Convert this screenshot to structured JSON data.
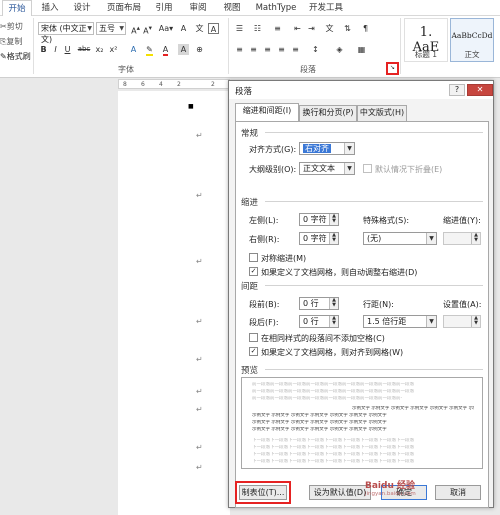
{
  "ribbon_tabs": [
    "开始",
    "插入",
    "设计",
    "页面布局",
    "引用",
    "审阅",
    "视图",
    "MathType",
    "开发工具"
  ],
  "clipboard": {
    "cut": "剪切",
    "copy": "复制",
    "painter": "格式刷"
  },
  "font": {
    "name": "宋体 (中文正文)",
    "size": "五号",
    "group_label": "字体"
  },
  "paragraph_group_label": "段落",
  "styles": [
    {
      "sample": "1. AaE",
      "name": "标题 1"
    },
    {
      "sample": "AaBbCcDd",
      "name": "正文"
    }
  ],
  "ruler_ticks": [
    "8",
    "6",
    "4",
    "2",
    "2"
  ],
  "dialog": {
    "title": "段落",
    "help": "?",
    "close": "✕",
    "tabs": [
      "缩进和间距(I)",
      "换行和分页(P)",
      "中文版式(H)"
    ],
    "general": {
      "section": "常规",
      "alignment_label": "对齐方式(G):",
      "alignment_value": "右对齐",
      "outline_label": "大纲级别(O):",
      "outline_value": "正文文本",
      "collapse_label": "默认情况下折叠(E)"
    },
    "indent": {
      "section": "缩进",
      "left_label": "左侧(L):",
      "left_value": "0 字符",
      "right_label": "右侧(R):",
      "right_value": "0 字符",
      "special_label": "特殊格式(S):",
      "special_value": "(无)",
      "by_label": "缩进值(Y):",
      "mirror_label": "对称缩进(M)",
      "auto_adjust_label": "如果定义了文档网格，则自动调整右缩进(D)"
    },
    "spacing": {
      "section": "间距",
      "before_label": "段前(B):",
      "before_value": "0 行",
      "after_label": "段后(F):",
      "after_value": "0 行",
      "line_label": "行距(N):",
      "line_value": "1.5 倍行距",
      "at_label": "设置值(A):",
      "no_space_label": "在相同样式的段落间不添加空格(C)",
      "snap_label": "如果定义了文档网格，则对齐到网格(W)"
    },
    "preview": {
      "section": "预览",
      "grey_text": "前一段落前一段落前一段落前一段落前一段落前一段落前一段落前一段落前一段落",
      "sample_text": "示例文字 示例文字 示例文字 示例文字 示例文字 示例文字 示例文字",
      "next_text": "下一段落下一段落下一段落下一段落下一段落下一段落下一段落下一段落下一段落"
    },
    "buttons": {
      "tabs": "制表位(T)...",
      "default": "设为默认值(D)",
      "ok": "确定",
      "cancel": "取消"
    }
  },
  "watermark": {
    "text": "Baidu 经验",
    "sub": "jingyan.baidu.com"
  },
  "colors": {
    "accent": "#2b579a",
    "highlight": "#e52222",
    "selection": "#3b78d6"
  }
}
